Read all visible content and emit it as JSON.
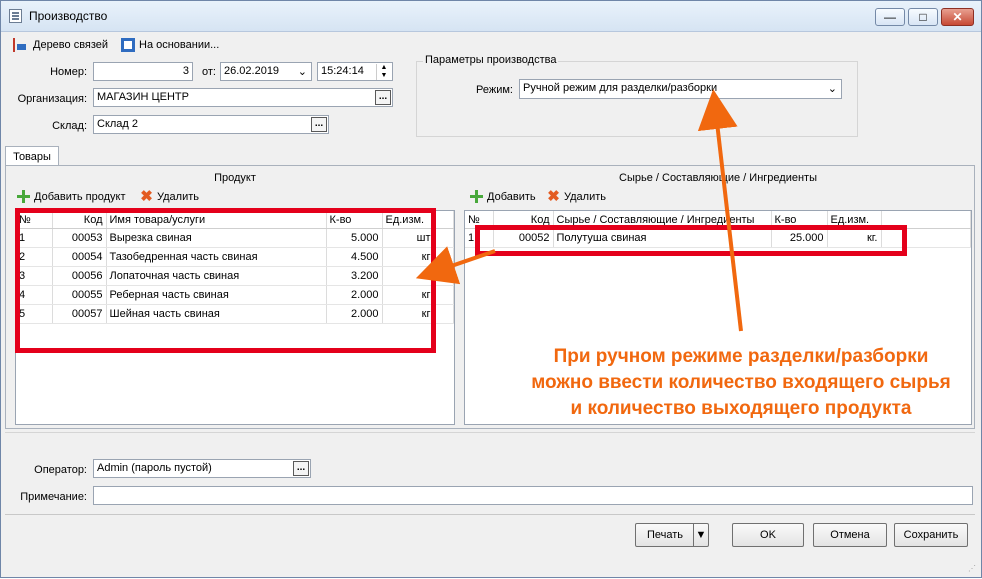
{
  "window": {
    "title": "Производство",
    "min_glyph": "—",
    "max_glyph": "□",
    "close_glyph": "✕"
  },
  "toolbar": {
    "tree_label": "Дерево связей",
    "based_label": "На основании..."
  },
  "header": {
    "number_label": "Номер:",
    "number_value": "3",
    "from_label": "от:",
    "date_value": "26.02.2019",
    "time_value": "15:24:14",
    "org_label": "Организация:",
    "org_value": "МАГАЗИН ЦЕНТР",
    "warehouse_label": "Склад:",
    "warehouse_value": "Склад 2",
    "ellipsis": "..."
  },
  "params": {
    "group_title": "Параметры производства",
    "mode_label": "Режим:",
    "mode_value": "Ручной режим для разделки/разборки"
  },
  "tabs": {
    "goods": "Товары"
  },
  "product_pane": {
    "title": "Продукт",
    "add_label": "Добавить продукт",
    "delete_label": "Удалить",
    "columns": [
      "№",
      "Код",
      "Имя товара/услуги",
      "К-во",
      "Ед.изм."
    ],
    "rows": [
      [
        "1",
        "00053",
        "Вырезка свиная",
        "5.000",
        "шт"
      ],
      [
        "2",
        "00054",
        "Тазобедренная часть свиная",
        "4.500",
        "кг"
      ],
      [
        "3",
        "00056",
        "Лопаточная часть свиная",
        "3.200",
        "кг"
      ],
      [
        "4",
        "00055",
        "Реберная часть свиная",
        "2.000",
        "кг"
      ],
      [
        "5",
        "00057",
        "Шейная часть свиная",
        "2.000",
        "кг"
      ]
    ]
  },
  "raw_pane": {
    "title": "Сырье / Составляющие / Ингредиенты",
    "add_label": "Добавить",
    "delete_label": "Удалить",
    "columns": [
      "№",
      "Код",
      "Сырье / Составляющие / Ингредиенты",
      "К-во",
      "Ед.изм."
    ],
    "rows": [
      [
        "1",
        "00052",
        "Полутуша свиная",
        "25.000",
        "кг."
      ]
    ]
  },
  "footer": {
    "operator_label": "Оператор:",
    "operator_value": "Admin (пароль пустой)",
    "note_label": "Примечание:",
    "note_value": ""
  },
  "buttons": {
    "print": "Печать",
    "ok": "OK",
    "cancel": "Отмена",
    "save": "Сохранить",
    "split_arrow": "▼"
  },
  "annotation": {
    "line1": "При ручном режиме разделки/разборки",
    "line2": "можно ввести количество входящего сырья",
    "line3": "и количество выходящего продукта",
    "color": "#f1680f"
  }
}
